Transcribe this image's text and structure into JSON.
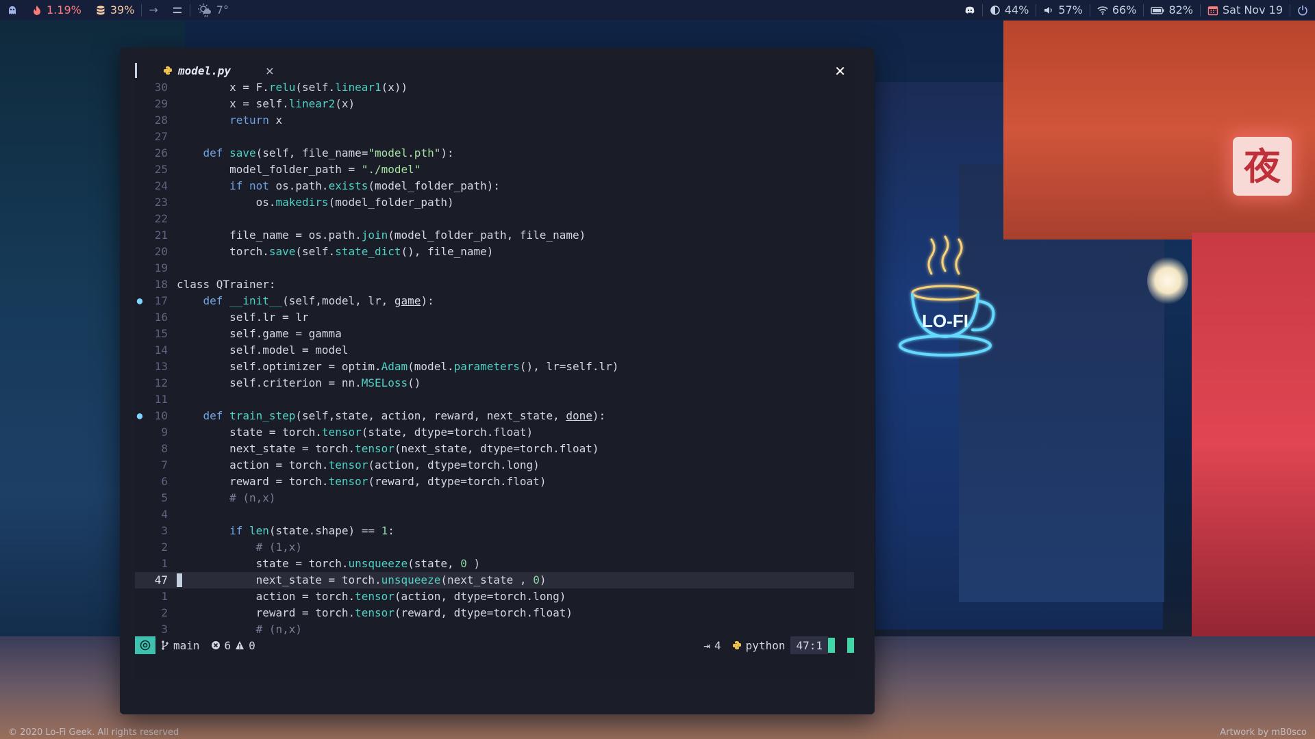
{
  "topbar": {
    "cpu": "1.19%",
    "memory": "39%",
    "weather_temp": "7°",
    "brightness": "44%",
    "volume": "57%",
    "wifi": "66%",
    "battery": "82%",
    "date": "Sat Nov 19"
  },
  "editor": {
    "tab_name": "model.py",
    "lines": [
      {
        "n": "30",
        "code": [
          [
            "",
            "        x = F."
          ],
          [
            "fn",
            "relu"
          ],
          [
            "",
            "(self."
          ],
          [
            "fn",
            "linear1"
          ],
          [
            "",
            "(x))"
          ]
        ]
      },
      {
        "n": "29",
        "code": [
          [
            "",
            "        x = self."
          ],
          [
            "fn",
            "linear2"
          ],
          [
            "",
            "(x)"
          ]
        ]
      },
      {
        "n": "28",
        "code": [
          [
            "",
            "        "
          ],
          [
            "kw",
            "return"
          ],
          [
            "",
            " x"
          ]
        ]
      },
      {
        "n": "27",
        "code": [
          [
            "",
            ""
          ]
        ]
      },
      {
        "n": "26",
        "code": [
          [
            "",
            "    "
          ],
          [
            "kw",
            "def"
          ],
          [
            "",
            " "
          ],
          [
            "fn",
            "save"
          ],
          [
            "",
            "(self, file_name="
          ],
          [
            "str",
            "\"model.pth\""
          ],
          [
            "",
            "):"
          ]
        ]
      },
      {
        "n": "25",
        "code": [
          [
            "",
            "        model_folder_path = "
          ],
          [
            "str",
            "\"./model\""
          ]
        ]
      },
      {
        "n": "24",
        "code": [
          [
            "",
            "        "
          ],
          [
            "kw",
            "if not"
          ],
          [
            "",
            " os.path."
          ],
          [
            "fn",
            "exists"
          ],
          [
            "",
            "(model_folder_path):"
          ]
        ]
      },
      {
        "n": "23",
        "code": [
          [
            "",
            "            os."
          ],
          [
            "fn",
            "makedirs"
          ],
          [
            "",
            "(model_folder_path)"
          ]
        ]
      },
      {
        "n": "22",
        "code": [
          [
            "",
            ""
          ]
        ]
      },
      {
        "n": "21",
        "code": [
          [
            "",
            "        file_name = os.path."
          ],
          [
            "fn",
            "join"
          ],
          [
            "",
            "(model_folder_path, file_name)"
          ]
        ]
      },
      {
        "n": "20",
        "code": [
          [
            "",
            "        torch."
          ],
          [
            "fn",
            "save"
          ],
          [
            "",
            "(self."
          ],
          [
            "fn",
            "state_dict"
          ],
          [
            "",
            "(), file_name)"
          ]
        ]
      },
      {
        "n": "19",
        "code": [
          [
            "",
            ""
          ]
        ]
      },
      {
        "n": "18",
        "code": [
          [
            "",
            "class QTrainer:"
          ]
        ]
      },
      {
        "n": "17",
        "sign": "hint",
        "code": [
          [
            "",
            "    "
          ],
          [
            "kw",
            "def"
          ],
          [
            "",
            " "
          ],
          [
            "fn",
            "__init__"
          ],
          [
            "",
            "(self,model, lr, "
          ],
          [
            "ul",
            "game"
          ],
          [
            "",
            "):"
          ]
        ]
      },
      {
        "n": "16",
        "code": [
          [
            "",
            "        self.lr = lr"
          ]
        ]
      },
      {
        "n": "15",
        "code": [
          [
            "",
            "        self.game = gamma"
          ]
        ]
      },
      {
        "n": "14",
        "code": [
          [
            "",
            "        self.model = model"
          ]
        ]
      },
      {
        "n": "13",
        "code": [
          [
            "",
            "        self.optimizer = optim."
          ],
          [
            "fn",
            "Adam"
          ],
          [
            "",
            "(model."
          ],
          [
            "fn",
            "parameters"
          ],
          [
            "",
            "(), lr=self.lr)"
          ]
        ]
      },
      {
        "n": "12",
        "code": [
          [
            "",
            "        self.criterion = nn."
          ],
          [
            "fn",
            "MSELoss"
          ],
          [
            "",
            "()"
          ]
        ]
      },
      {
        "n": "11",
        "code": [
          [
            "",
            ""
          ]
        ]
      },
      {
        "n": "10",
        "sign": "hint",
        "code": [
          [
            "",
            "    "
          ],
          [
            "kw",
            "def"
          ],
          [
            "",
            " "
          ],
          [
            "fn",
            "train_step"
          ],
          [
            "",
            "(self,state, action, reward, next_state, "
          ],
          [
            "ul",
            "done"
          ],
          [
            "",
            "):"
          ]
        ]
      },
      {
        "n": "9",
        "code": [
          [
            "",
            "        state = torch."
          ],
          [
            "fn",
            "tensor"
          ],
          [
            "",
            "(state, dtype=torch.float)"
          ]
        ]
      },
      {
        "n": "8",
        "code": [
          [
            "",
            "        next_state = torch."
          ],
          [
            "fn",
            "tensor"
          ],
          [
            "",
            "(next_state, dtype=torch.float)"
          ]
        ]
      },
      {
        "n": "7",
        "code": [
          [
            "",
            "        action = torch."
          ],
          [
            "fn",
            "tensor"
          ],
          [
            "",
            "(action, dtype=torch.long)"
          ]
        ]
      },
      {
        "n": "6",
        "code": [
          [
            "",
            "        reward = torch."
          ],
          [
            "fn",
            "tensor"
          ],
          [
            "",
            "(reward, dtype=torch.float)"
          ]
        ]
      },
      {
        "n": "5",
        "code": [
          [
            "",
            "        "
          ],
          [
            "cm",
            "# (n,x)"
          ]
        ]
      },
      {
        "n": "4",
        "code": [
          [
            "",
            ""
          ]
        ]
      },
      {
        "n": "3",
        "code": [
          [
            "",
            "        "
          ],
          [
            "kw",
            "if"
          ],
          [
            "",
            " "
          ],
          [
            "fn",
            "len"
          ],
          [
            "",
            "(state.shape) == "
          ],
          [
            "num",
            "1"
          ],
          [
            "",
            ":"
          ]
        ]
      },
      {
        "n": "2",
        "code": [
          [
            "",
            "            "
          ],
          [
            "cm",
            "# (1,x)"
          ]
        ]
      },
      {
        "n": "1",
        "code": [
          [
            "",
            "            state = torch."
          ],
          [
            "fn",
            "unsqueeze"
          ],
          [
            "",
            "(state, "
          ],
          [
            "num",
            "0"
          ],
          [
            "",
            " )"
          ]
        ]
      },
      {
        "n": "47",
        "current": true,
        "code": [
          [
            "",
            "            next_state = torch."
          ],
          [
            "fn",
            "unsqueeze"
          ],
          [
            "",
            "(next_state , "
          ],
          [
            "num",
            "0"
          ],
          [
            "",
            ")"
          ]
        ]
      },
      {
        "n": "1",
        "code": [
          [
            "",
            "            action = torch."
          ],
          [
            "fn",
            "tensor"
          ],
          [
            "",
            "(action, dtype=torch.long)"
          ]
        ]
      },
      {
        "n": "2",
        "code": [
          [
            "",
            "            reward = torch."
          ],
          [
            "fn",
            "tensor"
          ],
          [
            "",
            "(reward, dtype=torch.float)"
          ]
        ]
      },
      {
        "n": "3",
        "code": [
          [
            "",
            "            "
          ],
          [
            "cm",
            "# (n,x)"
          ]
        ]
      }
    ]
  },
  "statusline": {
    "branch": "main",
    "errors": "6",
    "warnings": "0",
    "indent": "4",
    "filetype": "python",
    "position": "47:1"
  },
  "footer": {
    "left": "© 2020 Lo-Fi Geek. All rights reserved",
    "right": "Artwork by mB0sco"
  },
  "wallpaper": {
    "sign_text": "LO-FI",
    "kanji": "夜"
  }
}
